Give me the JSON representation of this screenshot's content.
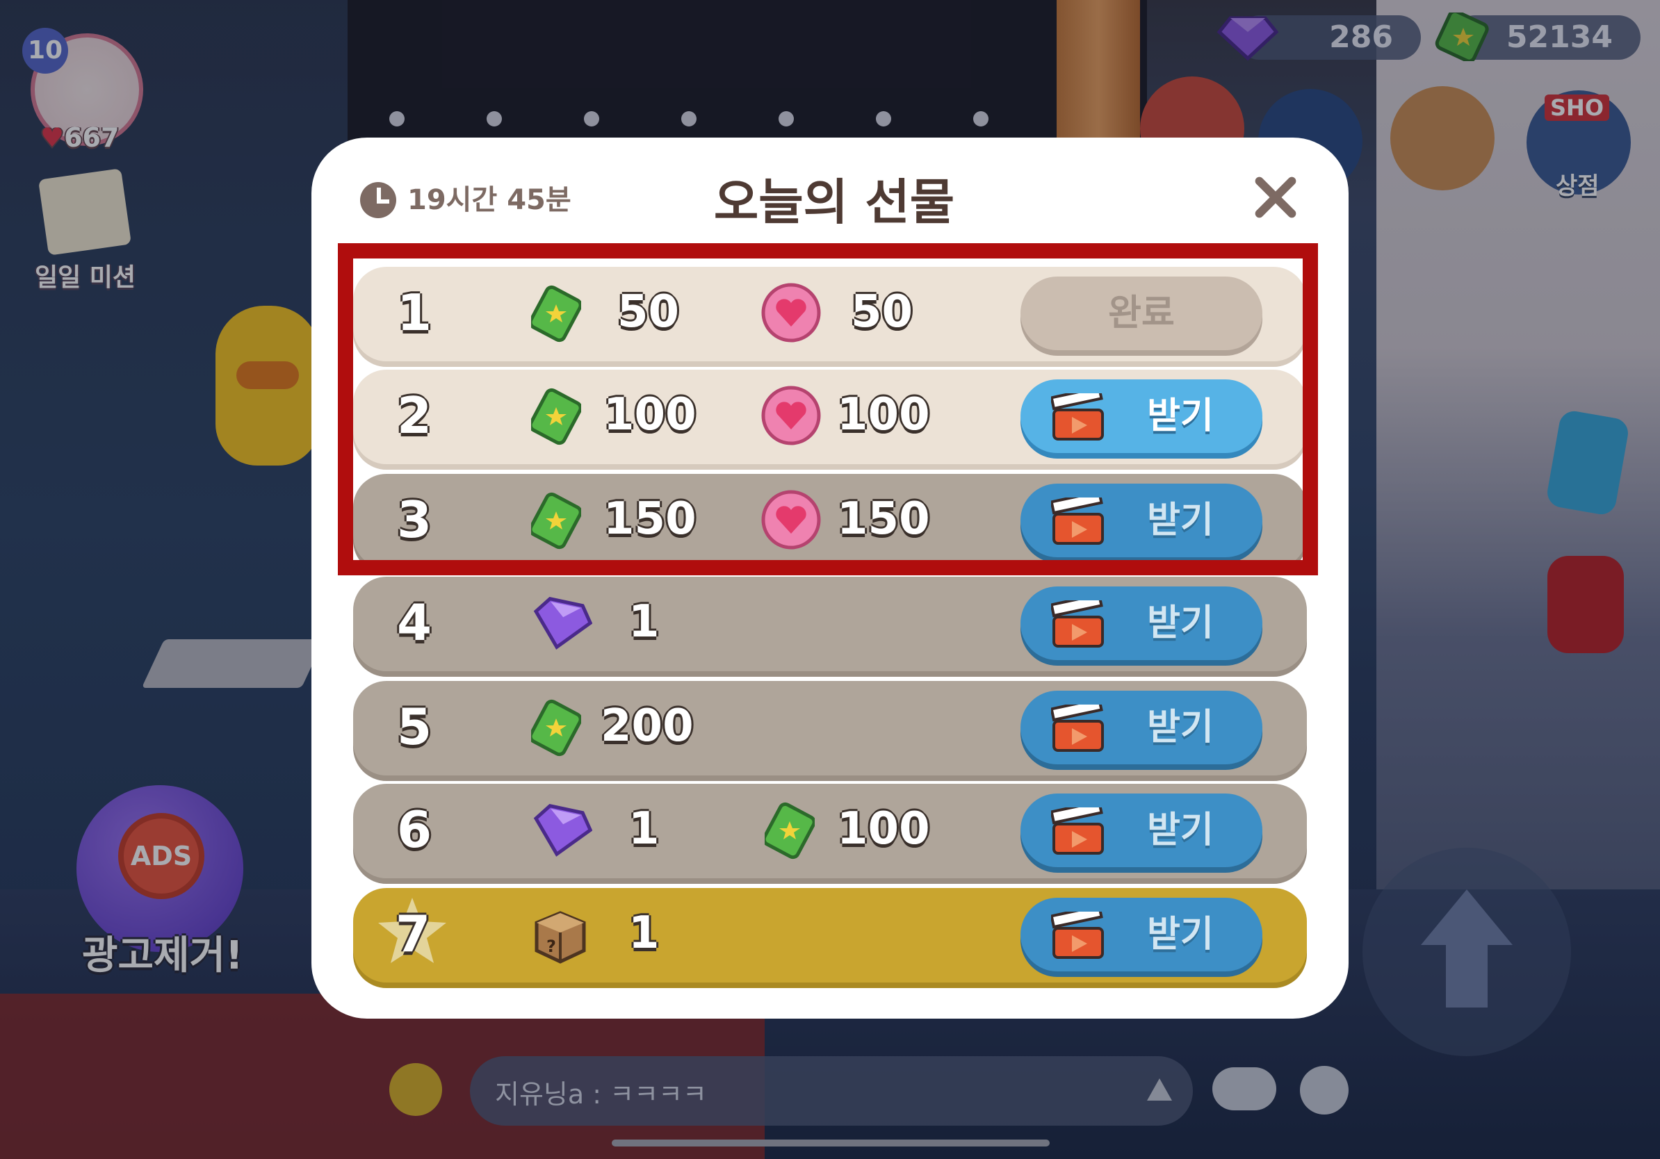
{
  "hud": {
    "level": "10",
    "hearts": "667",
    "mission_label": "일일 미션",
    "gems": "286",
    "cash": "52134",
    "shop_badge": "SHO",
    "shop_label": "상점",
    "ads_badge_text": "ADS",
    "ads_label": "광고제거!",
    "chat_text": "지유닝a : ㅋㅋㅋㅋ"
  },
  "dialog": {
    "timer": "19시간 45분",
    "title": "오늘의 선물",
    "rows": [
      {
        "day": "1",
        "reward1_icon": "cash-icon",
        "reward1": "50",
        "reward2_icon": "heart-coin-icon",
        "reward2": "50",
        "button": "완료",
        "state": "done"
      },
      {
        "day": "2",
        "reward1_icon": "cash-icon",
        "reward1": "100",
        "reward2_icon": "heart-coin-icon",
        "reward2": "100",
        "button": "받기",
        "state": "available"
      },
      {
        "day": "3",
        "reward1_icon": "cash-icon",
        "reward1": "150",
        "reward2_icon": "heart-coin-icon",
        "reward2": "150",
        "button": "받기",
        "state": "locked"
      },
      {
        "day": "4",
        "reward1_icon": "gem-icon",
        "reward1": "1",
        "button": "받기",
        "state": "locked"
      },
      {
        "day": "5",
        "reward1_icon": "cash-icon",
        "reward1": "200",
        "button": "받기",
        "state": "locked"
      },
      {
        "day": "6",
        "reward1_icon": "gem-icon",
        "reward1": "1",
        "reward2_icon": "cash-icon",
        "reward2": "100",
        "button": "받기",
        "state": "locked"
      },
      {
        "day": "7",
        "reward1_icon": "mystery-box-icon",
        "reward1": "1",
        "button": "받기",
        "state": "locked"
      }
    ]
  },
  "colors": {
    "highlight": "#b00d0d",
    "button_blue": "#56b3e6",
    "row_gold": "#c9a52f"
  }
}
